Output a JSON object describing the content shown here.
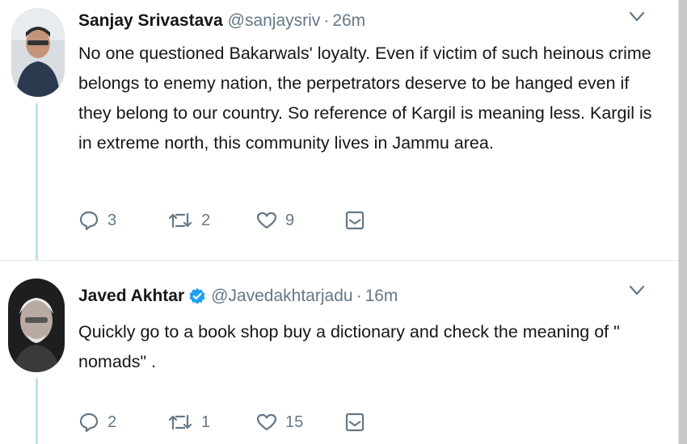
{
  "tweets": [
    {
      "name": "Sanjay Srivastava",
      "verified": false,
      "handle": "@sanjaysriv",
      "separator": "·",
      "time": "26m",
      "text": "No one questioned Bakarwals' loyalty. Even if victim of such heinous crime belongs to enemy nation, the perpetrators deserve to be hanged even if they belong to our country. So reference of Kargil is meaning less. Kargil is in extreme north, this community lives in Jammu area.",
      "replies": "3",
      "retweets": "2",
      "likes": "9"
    },
    {
      "name": "Javed Akhtar",
      "verified": true,
      "handle": "@Javedakhtarjadu",
      "separator": "·",
      "time": "16m",
      "text": "Quickly go to a book shop buy a dictionary and  check  the meaning of  \" nomads\" .",
      "replies": "2",
      "retweets": "1",
      "likes": "15"
    }
  ],
  "icons": {
    "reply": "reply-icon",
    "retweet": "retweet-icon",
    "like": "heart-icon",
    "message": "direct-message-icon",
    "caret": "chevron-down-icon",
    "verified": "verified-badge-icon"
  },
  "colors": {
    "icon_gray": "#657786",
    "thread_line": "#bde0f5",
    "verified_blue": "#1da1f2"
  }
}
